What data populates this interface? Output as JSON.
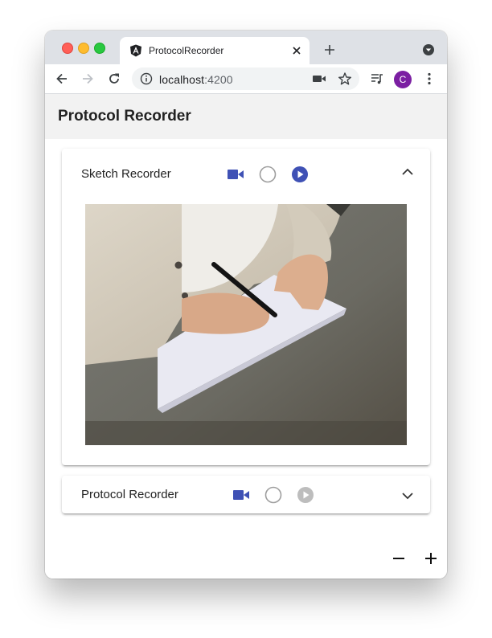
{
  "browser": {
    "tab_title": "ProtocolRecorder",
    "url_host": "localhost",
    "url_port": ":4200",
    "profile_initial": "C"
  },
  "app": {
    "title": "Protocol Recorder",
    "panels": [
      {
        "label": "Sketch Recorder",
        "expanded": true,
        "play_enabled": true
      },
      {
        "label": "Protocol Recorder",
        "expanded": false,
        "play_enabled": false
      }
    ]
  },
  "colors": {
    "accent": "#3f51b5",
    "disabled": "#bdbdbd",
    "avatar": "#7b1fa2"
  },
  "icons": [
    "angular-icon",
    "close-icon",
    "plus-icon",
    "tab-menu-icon",
    "back-icon",
    "forward-icon",
    "reload-icon",
    "info-icon",
    "camera-icon",
    "star-icon",
    "media-control-icon",
    "kebab-menu-icon",
    "video-camera-icon",
    "record-icon",
    "play-icon",
    "chevron-up-icon",
    "chevron-down-icon",
    "minus-icon"
  ]
}
